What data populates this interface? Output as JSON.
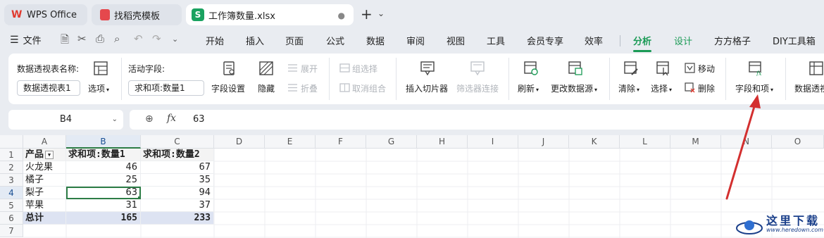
{
  "tabs": [
    {
      "label": "WPS Office"
    },
    {
      "label": "找稻壳模板"
    },
    {
      "label": "工作簿数量.xlsx",
      "dot": "●"
    }
  ],
  "tab_extra": {
    "plus": "+",
    "more": "⌄"
  },
  "menu": {
    "file": "文件",
    "items": [
      "开始",
      "插入",
      "页面",
      "公式",
      "数据",
      "审阅",
      "视图",
      "工具",
      "会员专享",
      "效率",
      "分析",
      "设计",
      "方方格子",
      "DIY工具箱"
    ],
    "active": "分析",
    "accent": "#1a9a55"
  },
  "ribbon": {
    "pt_name_label": "数据透视表名称:",
    "pt_name_value": "数据透视表1",
    "options": "选项",
    "active_field_label": "活动字段:",
    "active_field_value": "求和项:数量1",
    "field_settings": "字段设置",
    "hide": "隐藏",
    "expand": "展开",
    "collapse": "折叠",
    "group_selection": "组选择",
    "ungroup": "取消组合",
    "insert_slicer": "插入切片器",
    "filter_connections": "筛选器连接",
    "refresh": "刷新",
    "change_source": "更改数据源",
    "clear": "清除",
    "select": "选择",
    "move": "移动",
    "delete": "删除",
    "fields_items": "字段和项",
    "pt_more": "数据透视"
  },
  "formula_bar": {
    "cell_ref": "B4",
    "fx": "fx",
    "value": "63"
  },
  "sheet": {
    "columns": [
      "A",
      "B",
      "C",
      "D",
      "E",
      "F",
      "G",
      "H",
      "I",
      "J",
      "K",
      "L",
      "M",
      "N",
      "O"
    ],
    "rows": [
      "1",
      "2",
      "3",
      "4",
      "5",
      "6",
      "7"
    ],
    "header": {
      "a": "产品",
      "b": "求和项:数量1",
      "c": "求和项:数量2"
    },
    "data": [
      {
        "a": "火龙果",
        "b": "46",
        "c": "67"
      },
      {
        "a": "橘子",
        "b": "25",
        "c": "35"
      },
      {
        "a": "梨子",
        "b": "63",
        "c": "94"
      },
      {
        "a": "苹果",
        "b": "31",
        "c": "37"
      }
    ],
    "total": {
      "a": "总计",
      "b": "165",
      "c": "233"
    }
  },
  "watermark": {
    "brand": "这里下载",
    "url": "www.heredown.com"
  }
}
